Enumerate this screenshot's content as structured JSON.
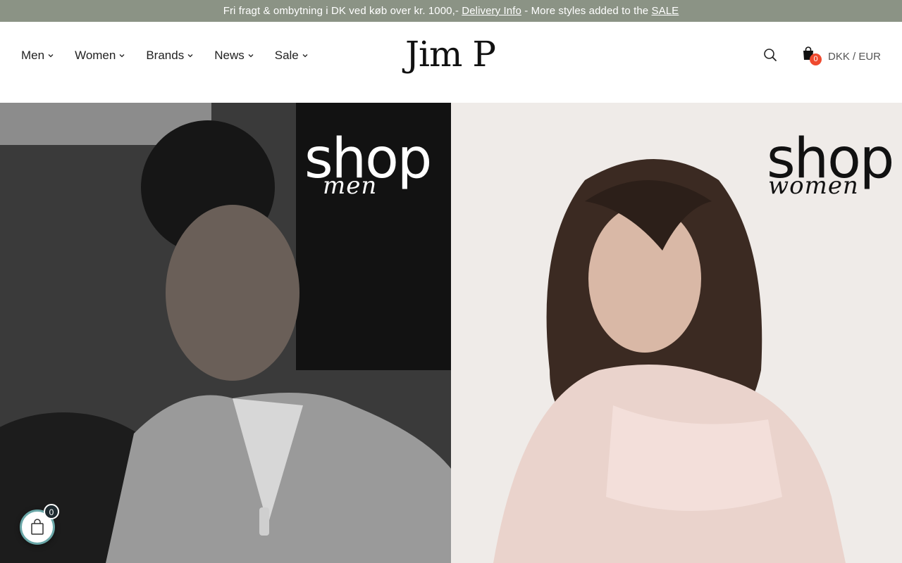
{
  "announcement": {
    "text_before": "Fri fragt & ombytning i DK ved køb over kr. 1000,-",
    "delivery_link": "Delivery Info",
    "text_middle": "- More styles added to the",
    "sale_link": "SALE"
  },
  "nav": {
    "items": [
      {
        "label": "Men"
      },
      {
        "label": "Women"
      },
      {
        "label": "Brands"
      },
      {
        "label": "News"
      },
      {
        "label": "Sale"
      }
    ]
  },
  "logo": {
    "text": "Jim P"
  },
  "header_actions": {
    "cart_count": "0",
    "currency": "DKK / EUR"
  },
  "hero": {
    "men": {
      "title": "shop",
      "subtitle": "men"
    },
    "women": {
      "title": "shop",
      "subtitle": "women"
    }
  },
  "floating_cart": {
    "count": "0"
  },
  "icons": {
    "search": "search-icon",
    "cart": "shopping-bag-icon",
    "chevron": "chevron-down-icon"
  },
  "colors": {
    "announcement_bg": "#8b9385",
    "cart_badge": "#ef4a2f",
    "floating_cart_ring": "#6aa7a8"
  }
}
